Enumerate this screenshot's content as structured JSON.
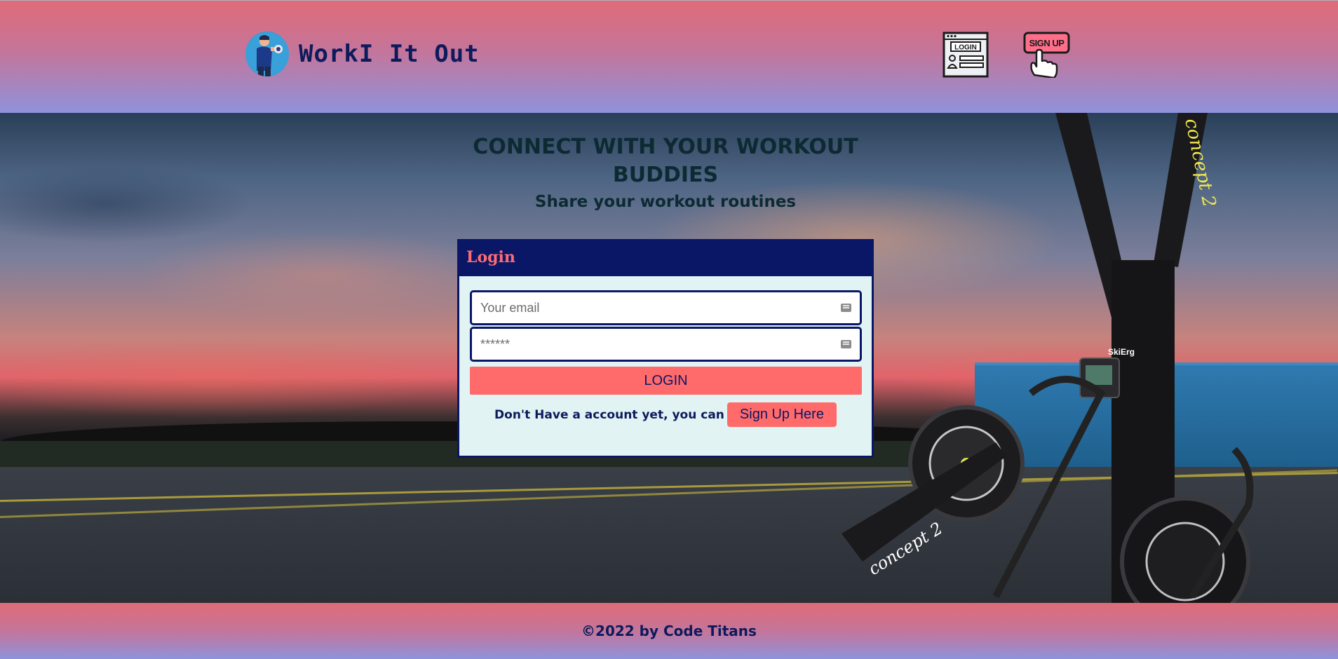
{
  "header": {
    "brand_name": "WorkI It Out",
    "login_icon_text": "LOGIN",
    "signup_icon_text": "SIGN UP"
  },
  "hero": {
    "headline": "CONNECT WITH YOUR WORKOUT BUDDIES",
    "subline": "Share your workout routines",
    "machine_brand": "concept 2",
    "machine_model": "SkiErg"
  },
  "login_form": {
    "title": "Login",
    "email_placeholder": "Your email",
    "password_placeholder": "******",
    "submit_label": "LOGIN",
    "signup_prompt": "Don't Have a account yet, you can",
    "signup_button_label": "Sign Up Here"
  },
  "footer": {
    "copyright": "©2022 by Code Titans"
  },
  "colors": {
    "navy": "#0a1766",
    "coral": "#ff6b6b",
    "panel_bg": "#e1f3f3",
    "header_top": "#e06c78",
    "header_bottom": "#8f92dc"
  }
}
